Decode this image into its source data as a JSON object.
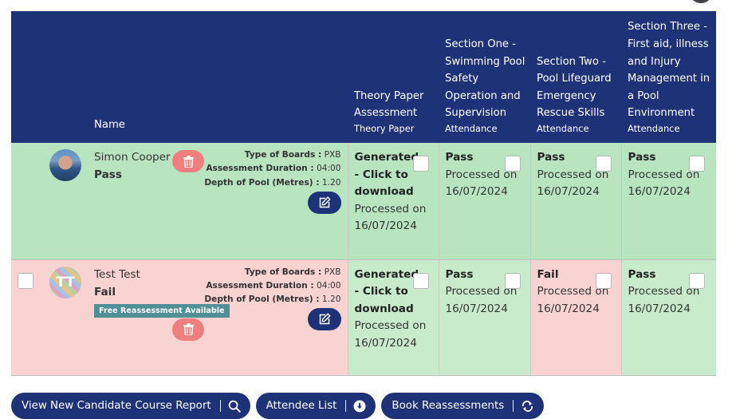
{
  "table": {
    "headers": {
      "name": "Name",
      "theory": {
        "title": "Theory Paper Assessment",
        "sub": "Theory Paper"
      },
      "section1": {
        "title": "Section One - Swimming Pool Safety Operation and Supervision",
        "sub": "Attendance"
      },
      "section2": {
        "title": "Section Two - Pool Lifeguard Emergency Rescue Skills",
        "sub": "Attendance"
      },
      "section3": {
        "title": "Section Three - First aid, illness and Injury Management in a Pool Environment",
        "sub": "Attendance"
      }
    },
    "rows": [
      {
        "name": "Simon Cooper",
        "result": "Pass",
        "avatar_initials": "",
        "badge": "",
        "meta": {
          "boards_label": "Type of Boards :",
          "boards_value": "PXB",
          "duration_label": "Assessment Duration :",
          "duration_value": "04:00",
          "depth_label": "Depth of Pool (Metres) :",
          "depth_value": "1.20"
        },
        "theory": {
          "status": "Generated - Click to download",
          "detail": "Processed on 16/07/2024"
        },
        "section1": {
          "status": "Pass",
          "detail": "Processed on 16/07/2024"
        },
        "section2": {
          "status": "Pass",
          "detail": "Processed on 16/07/2024"
        },
        "section3": {
          "status": "Pass",
          "detail": "Processed on 16/07/2024"
        }
      },
      {
        "name": "Test Test",
        "result": "Fail",
        "avatar_initials": "TT",
        "badge": "Free Reassessment Available",
        "meta": {
          "boards_label": "Type of Boards :",
          "boards_value": "PXB",
          "duration_label": "Assessment Duration :",
          "duration_value": "04:00",
          "depth_label": "Depth of Pool (Metres) :",
          "depth_value": "1.20"
        },
        "theory": {
          "status": "Generated - Click to download",
          "detail": "Processed on 16/07/2024"
        },
        "section1": {
          "status": "Pass",
          "detail": "Processed on 16/07/2024"
        },
        "section2": {
          "status": "Fail",
          "detail": "Processed on 16/07/2024"
        },
        "section3": {
          "status": "Pass",
          "detail": "Processed on 16/07/2024"
        }
      }
    ]
  },
  "actions": {
    "report": {
      "label": "View New Candidate Course Report",
      "icon": "search-icon"
    },
    "attendee": {
      "label": "Attendee List",
      "icon": "download-circle-icon"
    },
    "reassess": {
      "label": "Book Reassessments",
      "icon": "refresh-icon"
    }
  },
  "colors": {
    "header_bg": "#1e3278",
    "pass_row": "#b8e4c0",
    "fail_row": "#f9d2d2",
    "delete_button": "#ef7f7f",
    "badge": "#4f8f95"
  }
}
